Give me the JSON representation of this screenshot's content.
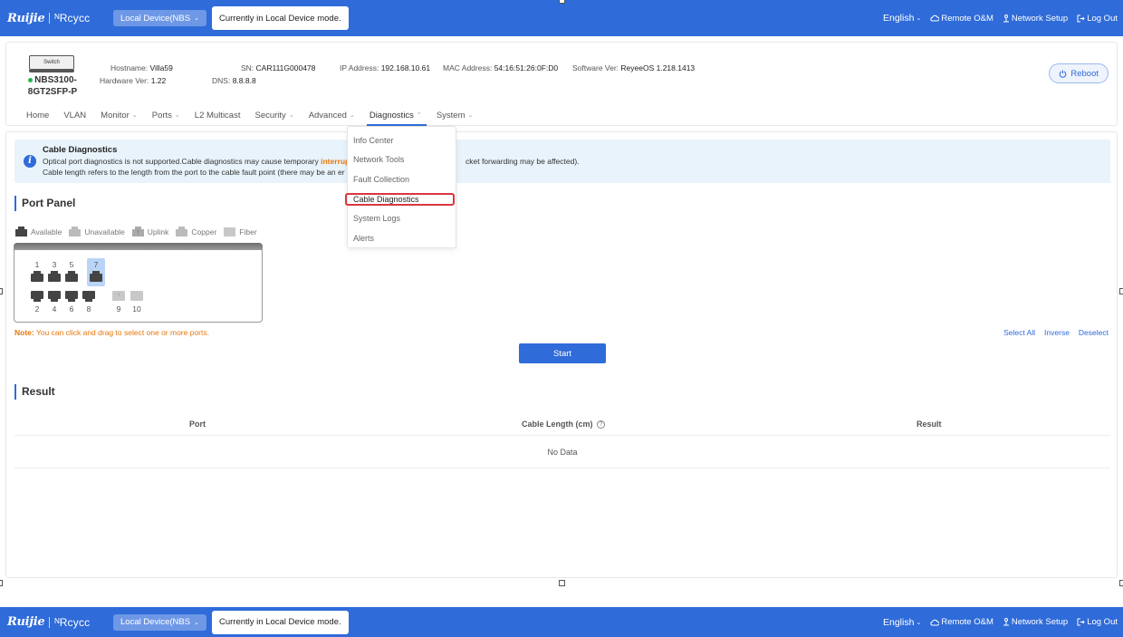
{
  "topbar": {
    "brand_ruijie": "Ruijie",
    "brand_reyee": "Rcycc",
    "device_select": "Local Device(NBS",
    "mode_tip": "Currently in Local Device mode.",
    "language": "English",
    "remote": "Remote O&M",
    "network_setup": "Network Setup",
    "logout": "Log Out"
  },
  "device": {
    "type_label": "Switch",
    "model_line1": "NBS3100-",
    "model_line2": "8GT2SFP-P",
    "status_color": "#2fb24c",
    "hostname_label": "Hostname:",
    "hostname": "Villa59",
    "sn_label": "SN:",
    "sn": "CAR111G000478",
    "ip_label": "IP Address:",
    "ip": "192.168.10.61",
    "mac_label": "MAC Address:",
    "mac": "54:16:51:26:0F:D0",
    "sw_label": "Software Ver:",
    "sw": "ReyeeOS 1.218.1413",
    "hw_label": "Hardware Ver:",
    "hw": "1.22",
    "dns_label": "DNS:",
    "dns": "8.8.8.8",
    "reboot": "Reboot"
  },
  "nav": {
    "home": "Home",
    "vlan": "VLAN",
    "monitor": "Monitor",
    "ports": "Ports",
    "l2": "L2 Multicast",
    "security": "Security",
    "advanced": "Advanced",
    "diagnostics": "Diagnostics",
    "system": "System"
  },
  "dropdown": {
    "items": [
      "Info Center",
      "Network Tools",
      "Fault Collection",
      "Cable Diagnostics",
      "System Logs",
      "Alerts"
    ]
  },
  "notice": {
    "title": "Cable Diagnostics",
    "line1_a": "Optical port diagnostics is not supported.Cable diagnostics may cause temporary ",
    "line1_warn": "interrup",
    "line1_b": "cket forwarding may be affected).",
    "line2": "Cable length refers to the length from the port to the cable fault point (there may be an er"
  },
  "port_panel": {
    "title": "Port Panel",
    "legend": [
      "Available",
      "Unavailable",
      "Uplink",
      "Copper",
      "Fiber"
    ],
    "top_ports": [
      "1",
      "3",
      "5",
      "7"
    ],
    "bottom_ports": [
      "2",
      "4",
      "6",
      "8"
    ],
    "fiber_ports": [
      "9",
      "10"
    ],
    "uplink_mark": "↑",
    "selected_port": "7",
    "note_label": "Note:",
    "note_text": " You can click and drag to select one or more ports.",
    "select_all": "Select All",
    "inverse": "Inverse",
    "deselect": "Deselect",
    "start": "Start"
  },
  "result": {
    "title": "Result",
    "col_port": "Port",
    "col_length": "Cable Length (cm)",
    "col_result": "Result",
    "help_mark": "?",
    "empty": "No Data"
  },
  "colors": {
    "primary": "#2f6bd9",
    "warning": "#e7770e",
    "highlight": "#d9363e"
  }
}
